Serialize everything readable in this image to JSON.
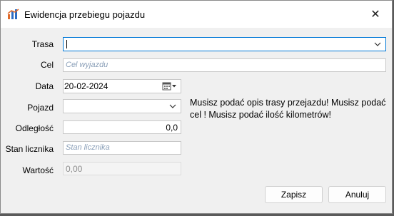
{
  "window": {
    "title": "Ewidencja przebiegu pojazdu",
    "close_glyph": "✕"
  },
  "icons": {
    "app": "chart-bars-icon",
    "close": "close-icon",
    "dropdown": "chevron-down-icon",
    "calendar": "calendar-icon"
  },
  "form": {
    "trasa": {
      "label": "Trasa",
      "value": ""
    },
    "cel": {
      "label": "Cel",
      "placeholder": "Cel wyjazdu"
    },
    "data": {
      "label": "Data",
      "value": "20-02-2024"
    },
    "pojazd": {
      "label": "Pojazd",
      "value": ""
    },
    "odleglosc": {
      "label": "Odległość",
      "value": "0,0"
    },
    "stan_licznika": {
      "label": "Stan licznika",
      "placeholder": "Stan licznika"
    },
    "wartosc": {
      "label": "Wartość",
      "value": "0,00"
    }
  },
  "validation_message": "Musisz podać opis trasy przejazdu! Musisz podać cel ! Musisz podać ilość kilometrów!",
  "buttons": {
    "save": "Zapisz",
    "cancel": "Anuluj"
  },
  "colors": {
    "focus_border": "#0078d7",
    "placeholder": "#8a9fb8"
  }
}
